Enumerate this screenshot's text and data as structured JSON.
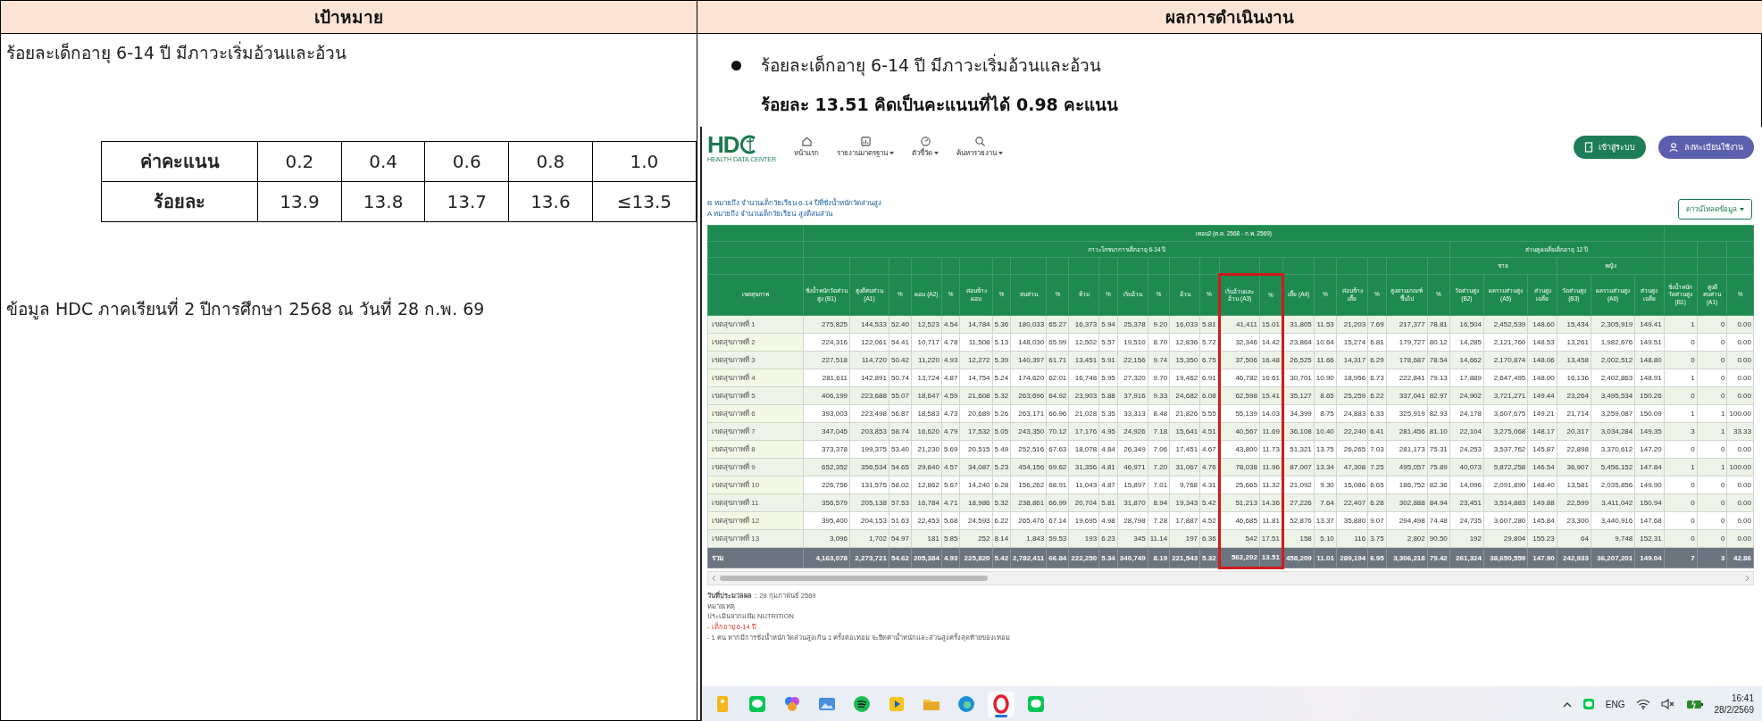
{
  "document": {
    "headers": [
      "เป้าหมาย",
      "ผลการดำเนินงาน"
    ],
    "goal": {
      "text": "ร้อยละเด็กอายุ 6-14 ปี มีภาวะเริ่มอ้วนและอ้วน",
      "score_table": [
        {
          "label": "ค่าคะแนน",
          "values": [
            "0.2",
            "0.4",
            "0.6",
            "0.8",
            "1.0"
          ]
        },
        {
          "label": "ร้อยละ",
          "values": [
            "13.9",
            "13.8",
            "13.7",
            "13.6",
            "≤13.5"
          ]
        }
      ],
      "source_note": "ข้อมูล HDC ภาคเรียนที่ 2 ปีการศึกษา 2568 ณ วันที่ 28 ก.พ. 69"
    },
    "result": {
      "text": "ร้อยละเด็กอายุ 6-14 ปี มีภาวะเริ่มอ้วนและอ้วน",
      "summary": "ร้อยละ 13.51 คิดเป็นคะแนนที่ได้ 0.98 คะแนน"
    }
  },
  "screenshot": {
    "logo": {
      "text": "HD",
      "subtitle": "HEALTH DATA CENTER"
    },
    "nav": [
      {
        "kind": "home",
        "label": "หน้าแรก",
        "dropdown": false
      },
      {
        "kind": "report",
        "label": "รายงานมาตรฐาน",
        "dropdown": true
      },
      {
        "kind": "gauge",
        "label": "ตัวชี้วัด",
        "dropdown": true
      },
      {
        "kind": "search",
        "label": "ค้นหารายงาน",
        "dropdown": true
      }
    ],
    "buttons": [
      {
        "kind": "login",
        "label": "เข้าสู่ระบบ"
      },
      {
        "kind": "register",
        "label": "ลงทะเบียนใช้งาน"
      }
    ],
    "legend": [
      "B หมายถึง จำนวนเด็กวัยเรียน 6-14 ปีที่ชั่งน้ำหนักวัดส่วนสูง",
      "A หมายถึง จำนวนเด็กวัยเรียน สูงดีสมส่วน"
    ],
    "download_button": "ดาวน์โหลดข้อมูล",
    "table": {
      "header": [
        {
          "label": "เขตสุขภาพ",
          "highlighted": false
        },
        {
          "label": "เทอม2 (ต.ค. 2568 - ก.พ. 2569)",
          "children": [
            {
              "label": "ภาวะโภชนาการเด็กอายุ 6-14 ปี",
              "children": [
                {
                  "label": "ชั่งน้ำหนักวัดส่วนสูง (B1)",
                  "highlighted": false
                },
                {
                  "label": "สูงดีสมส่วน (A1)",
                  "highlighted": false
                },
                {
                  "label": "%",
                  "highlighted": false
                },
                {
                  "label": "ผอม (A2)",
                  "highlighted": false
                },
                {
                  "label": "%",
                  "highlighted": false
                },
                {
                  "label": "ค่อนข้างผอม",
                  "highlighted": false
                },
                {
                  "label": "%",
                  "highlighted": false
                },
                {
                  "label": "สมส่วน",
                  "highlighted": false
                },
                {
                  "label": "%",
                  "highlighted": false
                },
                {
                  "label": "ท้วม",
                  "highlighted": false
                },
                {
                  "label": "%",
                  "highlighted": false
                },
                {
                  "label": "เริ่มอ้วน",
                  "highlighted": false
                },
                {
                  "label": "%",
                  "highlighted": false
                },
                {
                  "label": "อ้วน",
                  "highlighted": false
                },
                {
                  "label": "%",
                  "highlighted": false
                },
                {
                  "label": "เริ่มอ้วนและอ้วน (A3)",
                  "highlighted": true
                },
                {
                  "label": "%",
                  "highlighted": true
                },
                {
                  "label": "เตี้ย (A4)",
                  "highlighted": false
                },
                {
                  "label": "%",
                  "highlighted": false
                },
                {
                  "label": "ค่อนข้างเตี้ย",
                  "highlighted": false
                },
                {
                  "label": "%",
                  "highlighted": false
                },
                {
                  "label": "สูงตามเกณฑ์ขึ้นไป",
                  "highlighted": false
                },
                {
                  "label": "%",
                  "highlighted": false
                }
              ]
            },
            {
              "label": "ส่วนสูงเฉลี่ยเด็กอายุ 12 ปี",
              "children": [
                {
                  "label": "ชาย",
                  "children": [
                    {
                      "label": "วัดส่วนสูง (B2)",
                      "highlighted": false
                    },
                    {
                      "label": "ผลรวมส่วนสูง (A5)",
                      "highlighted": false
                    },
                    {
                      "label": "ส่วนสูงเฉลี่ย",
                      "highlighted": false
                    }
                  ]
                },
                {
                  "label": "หญิง",
                  "children": [
                    {
                      "label": "วัดส่วนสูง (B3)",
                      "highlighted": false
                    },
                    {
                      "label": "ผลรวมส่วนสูง (A6)",
                      "highlighted": false
                    },
                    {
                      "label": "ส่วนสูงเฉลี่ย",
                      "highlighted": false
                    }
                  ]
                }
              ]
            }
          ]
        },
        {
          "children": [
            {
              "label": "ชั่งน้ำหนักวัดส่วนสูง (B1)",
              "highlighted": false
            },
            {
              "label": "สูงดีสมส่วน (A1)",
              "highlighted": false
            },
            {
              "label": "%",
              "highlighted": false
            }
          ]
        }
      ],
      "rows": [
        [
          "เขตสุขภาพที่ 1",
          "275,825",
          "144,533",
          "52.40",
          "12,523",
          "4.54",
          "14,784",
          "5.36",
          "180,033",
          "65.27",
          "16,373",
          "5.94",
          "25,378",
          "9.20",
          "16,033",
          "5.81",
          "41,411",
          "15.01",
          "31,805",
          "11.53",
          "21,203",
          "7.69",
          "217,377",
          "78.81",
          "16,504",
          "2,452,539",
          "148.60",
          "15,434",
          "2,305,919",
          "149.41",
          "1",
          "0",
          "0.00"
        ],
        [
          "เขตสุขภาพที่ 2",
          "224,316",
          "122,061",
          "54.41",
          "10,717",
          "4.78",
          "11,508",
          "5.13",
          "148,030",
          "65.99",
          "12,502",
          "5.57",
          "19,510",
          "8.70",
          "12,836",
          "5.72",
          "32,346",
          "14.42",
          "23,864",
          "10.64",
          "15,274",
          "6.81",
          "179,727",
          "80.12",
          "14,285",
          "2,121,760",
          "148.53",
          "13,261",
          "1,982,676",
          "149.51",
          "0",
          "0",
          "0.00"
        ],
        [
          "เขตสุขภาพที่ 3",
          "227,518",
          "114,720",
          "50.42",
          "11,220",
          "4.93",
          "12,272",
          "5.39",
          "140,397",
          "61.71",
          "13,451",
          "5.91",
          "22,156",
          "9.74",
          "15,350",
          "6.75",
          "37,506",
          "16.48",
          "26,525",
          "11.66",
          "14,317",
          "6.29",
          "178,687",
          "78.54",
          "14,662",
          "2,170,874",
          "148.06",
          "13,458",
          "2,002,512",
          "148.80",
          "0",
          "0",
          "0.00"
        ],
        [
          "เขตสุขภาพที่ 4",
          "281,611",
          "142,891",
          "50.74",
          "13,724",
          "4.87",
          "14,754",
          "5.24",
          "174,620",
          "62.01",
          "16,748",
          "5.95",
          "27,320",
          "9.70",
          "19,462",
          "6.91",
          "46,782",
          "16.61",
          "30,701",
          "10.90",
          "18,956",
          "6.73",
          "222,841",
          "79.13",
          "17,889",
          "2,647,495",
          "148.00",
          "16,136",
          "2,402,863",
          "148.91",
          "1",
          "0",
          "0.00"
        ],
        [
          "เขตสุขภาพที่ 5",
          "406,199",
          "223,688",
          "55.07",
          "18,647",
          "4.59",
          "21,608",
          "5.32",
          "263,696",
          "64.92",
          "23,903",
          "5.88",
          "37,916",
          "9.33",
          "24,682",
          "6.08",
          "62,598",
          "15.41",
          "35,127",
          "8.65",
          "25,259",
          "6.22",
          "337,041",
          "82.97",
          "24,902",
          "3,721,271",
          "149.44",
          "23,264",
          "3,495,534",
          "150.26",
          "0",
          "0",
          "0.00"
        ],
        [
          "เขตสุขภาพที่ 6",
          "393,003",
          "223,498",
          "56.87",
          "18,583",
          "4.73",
          "20,689",
          "5.26",
          "263,171",
          "66.96",
          "21,028",
          "5.35",
          "33,313",
          "8.48",
          "21,826",
          "5.55",
          "55,139",
          "14.03",
          "34,399",
          "8.75",
          "24,883",
          "6.33",
          "325,919",
          "82.93",
          "24,178",
          "3,607,675",
          "149.21",
          "21,714",
          "3,259,087",
          "150.09",
          "1",
          "1",
          "100.00"
        ],
        [
          "เขตสุขภาพที่ 7",
          "347,045",
          "203,853",
          "58.74",
          "16,620",
          "4.79",
          "17,532",
          "5.05",
          "243,350",
          "70.12",
          "17,176",
          "4.95",
          "24,926",
          "7.18",
          "15,641",
          "4.51",
          "40,567",
          "11.69",
          "36,108",
          "10.40",
          "22,240",
          "6.41",
          "281,456",
          "81.10",
          "22,104",
          "3,275,068",
          "148.17",
          "20,317",
          "3,034,284",
          "149.35",
          "3",
          "1",
          "33.33"
        ],
        [
          "เขตสุขภาพที่ 8",
          "373,378",
          "199,375",
          "53.40",
          "21,230",
          "5.69",
          "20,515",
          "5.49",
          "252,516",
          "67.63",
          "18,078",
          "4.84",
          "26,349",
          "7.06",
          "17,451",
          "4.67",
          "43,800",
          "11.73",
          "51,321",
          "13.75",
          "26,265",
          "7.03",
          "281,173",
          "75.31",
          "24,253",
          "3,537,762",
          "145.87",
          "22,898",
          "3,370,612",
          "147.20",
          "0",
          "0",
          "0.00"
        ],
        [
          "เขตสุขภาพที่ 9",
          "652,352",
          "356,534",
          "54.65",
          "29,840",
          "4.57",
          "34,087",
          "5.23",
          "454,156",
          "69.62",
          "31,356",
          "4.81",
          "46,971",
          "7.20",
          "31,067",
          "4.76",
          "78,038",
          "11.96",
          "87,007",
          "13.34",
          "47,308",
          "7.25",
          "495,057",
          "75.89",
          "40,073",
          "5,872,258",
          "146.54",
          "36,907",
          "5,456,152",
          "147.84",
          "1",
          "1",
          "100.00"
        ],
        [
          "เขตสุขภาพที่ 10",
          "226,756",
          "131,575",
          "58.02",
          "12,862",
          "5.67",
          "14,240",
          "6.28",
          "156,262",
          "68.91",
          "11,043",
          "4.87",
          "15,897",
          "7.01",
          "9,768",
          "4.31",
          "25,665",
          "11.32",
          "21,092",
          "9.30",
          "15,086",
          "6.65",
          "186,752",
          "82.36",
          "14,096",
          "2,091,890",
          "148.40",
          "13,581",
          "2,035,856",
          "149.90",
          "0",
          "0",
          "0.00"
        ],
        [
          "เขตสุขภาพที่ 11",
          "356,579",
          "205,138",
          "57.53",
          "16,784",
          "4.71",
          "18,986",
          "5.32",
          "238,861",
          "66.99",
          "20,704",
          "5.81",
          "31,870",
          "8.94",
          "19,343",
          "5.42",
          "51,213",
          "14.36",
          "27,226",
          "7.64",
          "22,407",
          "6.28",
          "302,888",
          "84.94",
          "23,451",
          "3,514,883",
          "149.88",
          "22,599",
          "3,411,042",
          "150.94",
          "0",
          "0",
          "0.00"
        ],
        [
          "เขตสุขภาพที่ 12",
          "395,400",
          "204,153",
          "51.63",
          "22,453",
          "5.68",
          "24,593",
          "6.22",
          "265,476",
          "67.14",
          "19,695",
          "4.98",
          "28,798",
          "7.28",
          "17,887",
          "4.52",
          "46,685",
          "11.81",
          "52,876",
          "13.37",
          "35,880",
          "9.07",
          "294,498",
          "74.48",
          "24,735",
          "3,607,280",
          "145.84",
          "23,300",
          "3,440,916",
          "147.68",
          "0",
          "0",
          "0.00"
        ],
        [
          "เขตสุขภาพที่ 13",
          "3,096",
          "1,702",
          "54.97",
          "181",
          "5.85",
          "252",
          "8.14",
          "1,843",
          "59.53",
          "193",
          "6.23",
          "345",
          "11.14",
          "197",
          "6.36",
          "542",
          "17.51",
          "158",
          "5.10",
          "116",
          "3.75",
          "2,802",
          "90.50",
          "192",
          "29,804",
          "155.23",
          "64",
          "9,748",
          "152.31",
          "0",
          "0",
          "0.00"
        ]
      ],
      "total_row": [
        "รวม",
        "4,163,078",
        "2,273,721",
        "54.62",
        "205,384",
        "4.93",
        "225,820",
        "5.42",
        "2,782,411",
        "66.84",
        "222,250",
        "5.34",
        "340,749",
        "8.19",
        "221,543",
        "5.32",
        "562,292",
        "13.51",
        "458,209",
        "11.01",
        "289,194",
        "6.95",
        "3,306,218",
        "79.42",
        "261,324",
        "38,650,559",
        "147.90",
        "242,933",
        "36,207,201",
        "149.04",
        "7",
        "3",
        "42.86"
      ]
    },
    "notes": [
      {
        "kind": "label-value",
        "label": "วันที่ประมวลผล",
        "value": " :: 28 กุมภาพันธ์ 2569"
      },
      {
        "kind": "plain",
        "text": "หมายเหตุ"
      },
      {
        "kind": "plain",
        "text": "ประเมินจากแฟ้ม NUTRITION"
      },
      {
        "kind": "warning",
        "text": "- เด็กอายุ 6-14 ปี"
      },
      {
        "kind": "plain",
        "text": "- 1 คน หากมีการชั่งน้ำหนักวัดส่วนสูงเกิน 1 ครั้งต่อเทอม จะยึดค่าน้ำหนักและส่วนสูงครั้งสุดท้ายของเทอม"
      }
    ],
    "taskbar": {
      "apps": [
        {
          "kind": "note",
          "active": false
        },
        {
          "kind": "chat",
          "active": false
        },
        {
          "kind": "flower",
          "active": false
        },
        {
          "kind": "picture",
          "active": false
        },
        {
          "kind": "music",
          "active": false
        },
        {
          "kind": "player",
          "active": false
        },
        {
          "kind": "folder",
          "active": false
        },
        {
          "kind": "browser",
          "active": false
        },
        {
          "kind": "ring",
          "active": true
        },
        {
          "kind": "chat",
          "active": false
        }
      ],
      "language": "ENG",
      "time": "16:41",
      "date": "28/2/2569"
    }
  }
}
